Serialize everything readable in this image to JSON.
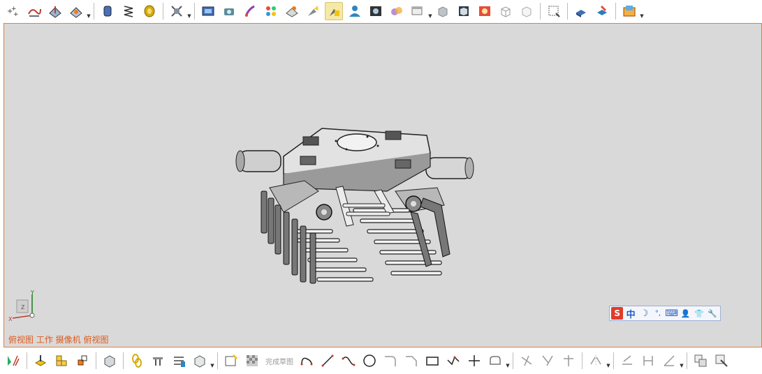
{
  "viewport": {
    "status_text": "俯视图 工作 摄像机 俯视图",
    "triad": {
      "x_label": "X",
      "y_label": "Y",
      "z_label": "Z"
    }
  },
  "bottom_toolbar": {
    "finish_sketch_label": "完成草图"
  },
  "ime_bar": {
    "logo": "S",
    "language": "中",
    "moon": "☽",
    "punct": "°,",
    "keyboard": "⌨",
    "user": "👤",
    "skin": "👕",
    "tools": "🔧"
  },
  "colors": {
    "viewport_bg": "#d9d9d9",
    "viewport_border": "#f07b2c",
    "status_text": "#e05a1b",
    "active_tool_bg": "#f5e9a8"
  },
  "icons": {
    "top": [
      "point-icon",
      "plane-icon",
      "datum-plane-icon",
      "sketch-plane-icon",
      "cylinder-icon",
      "spring-icon",
      "coil-icon",
      "block-icon",
      "render-icon",
      "camera-icon",
      "paint-icon",
      "color-palette-icon",
      "material-icon",
      "flashlight-icon",
      "highlight-icon",
      "user-icon",
      "image-icon",
      "scene-icon",
      "window-icon",
      "cube-gray-icon",
      "cube-shaded-icon",
      "photo-icon",
      "cube-wire-icon",
      "cube-outline-icon",
      "screenshot-icon",
      "export-icon",
      "pencil-box-icon",
      "folder-image-icon"
    ],
    "bottom": [
      "select-icon",
      "move-icon",
      "assembly-icon",
      "part-icon",
      "box-icon",
      "chain-icon",
      "tool-icon",
      "list-icon",
      "cube-dropdown-icon",
      "sketch-icon",
      "checker-icon",
      "arc-icon",
      "line-icon",
      "spline-icon",
      "circle-icon",
      "fillet-icon",
      "chamfer-icon",
      "rectangle-icon",
      "polyline-icon",
      "point-plus-icon",
      "offset-icon",
      "trim-icon",
      "extend-icon",
      "intersect-icon",
      "mirror-icon",
      "constraint-icon",
      "dimension-icon",
      "angle-icon",
      "copy-icon",
      "settings-icon"
    ]
  }
}
